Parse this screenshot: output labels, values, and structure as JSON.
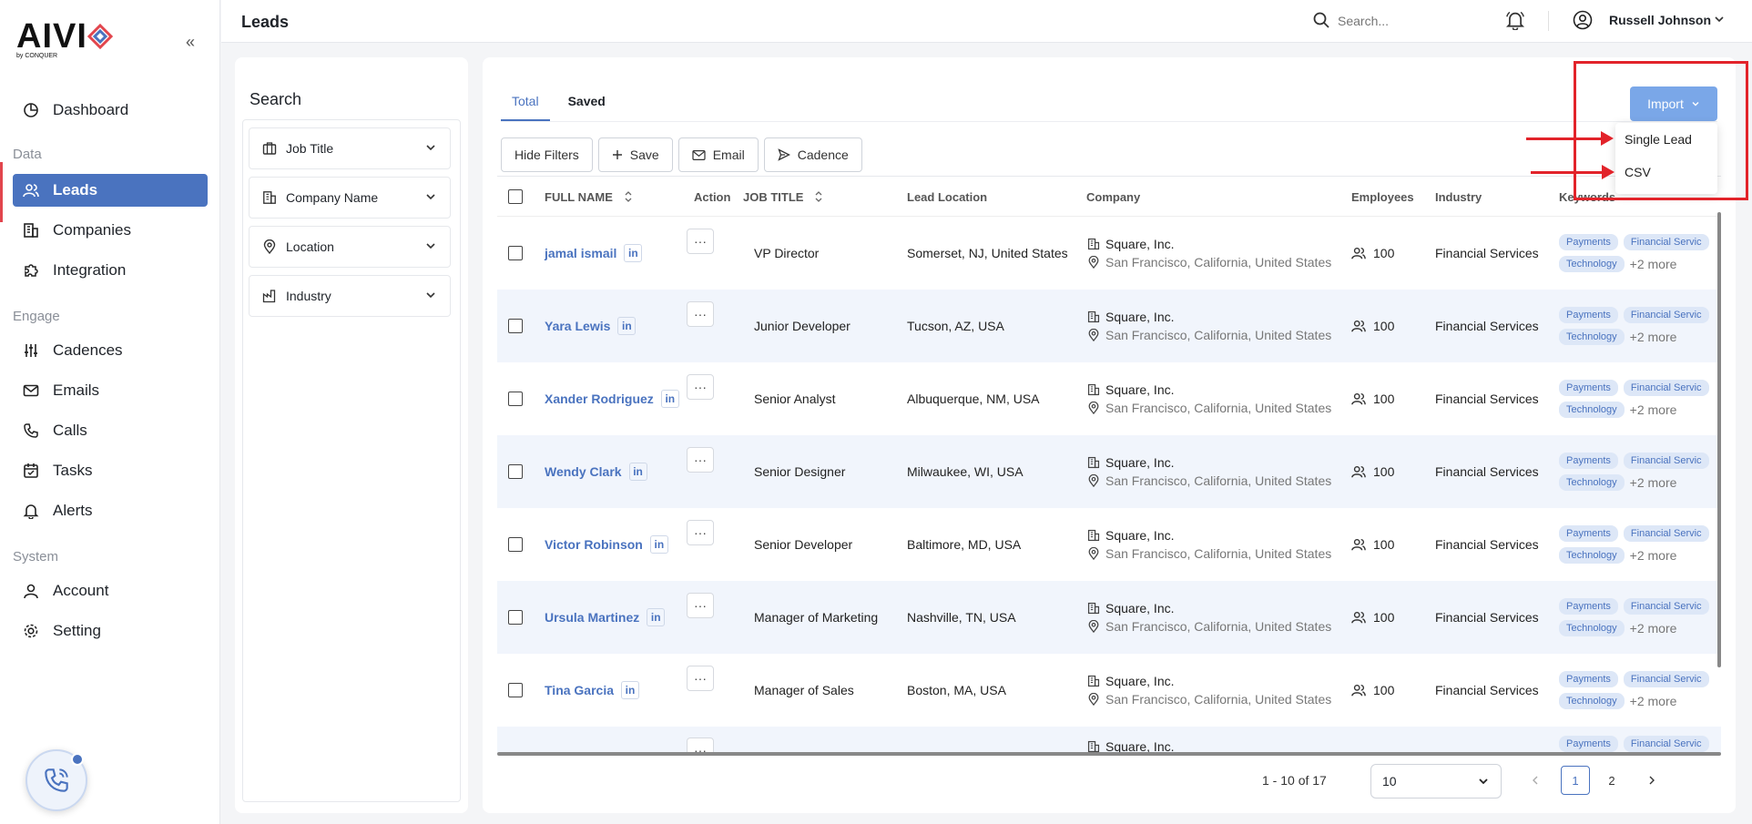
{
  "app": {
    "logo_text": "AIVI",
    "logo_sub": "by CONQUER"
  },
  "sidebar": {
    "items": [
      {
        "label": "Dashboard",
        "icon": "dashboard-icon"
      },
      {
        "label": "Leads",
        "icon": "users-icon",
        "active": true
      },
      {
        "label": "Companies",
        "icon": "building-icon"
      },
      {
        "label": "Integration",
        "icon": "puzzle-icon"
      },
      {
        "label": "Cadences",
        "icon": "sliders-icon"
      },
      {
        "label": "Emails",
        "icon": "mail-icon"
      },
      {
        "label": "Calls",
        "icon": "phone-icon"
      },
      {
        "label": "Tasks",
        "icon": "calendar-icon"
      },
      {
        "label": "Alerts",
        "icon": "bell-icon"
      },
      {
        "label": "Account",
        "icon": "user-icon"
      },
      {
        "label": "Setting",
        "icon": "gear-icon"
      }
    ],
    "sections": [
      "Data",
      "Engage",
      "System"
    ]
  },
  "header": {
    "title": "Leads",
    "search_placeholder": "Search...",
    "user_name": "Russell Johnson"
  },
  "filters": {
    "title": "Search",
    "items": [
      {
        "label": "Job Title"
      },
      {
        "label": "Company Name"
      },
      {
        "label": "Location"
      },
      {
        "label": "Industry"
      }
    ]
  },
  "main": {
    "tabs": [
      {
        "label": "Total",
        "active": true
      },
      {
        "label": "Saved"
      }
    ],
    "toolbar": {
      "hide_filters": "Hide Filters",
      "save": "Save",
      "email": "Email",
      "cadence": "Cadence"
    },
    "import": {
      "label": "Import",
      "menu": [
        "Single Lead",
        "CSV"
      ]
    },
    "table": {
      "columns": [
        "FULL NAME",
        "Action",
        "JOB TITLE",
        "Lead Location",
        "Company",
        "Employees",
        "Industry",
        "Keywords"
      ],
      "rows": [
        {
          "name": "jamal ismail",
          "title": "VP Director",
          "location": "Somerset, NJ, United States",
          "company": "Square, Inc.",
          "company_loc": "San Francisco, California, United States",
          "employees": "100",
          "industry": "Financial Services",
          "kw1": "Payments",
          "kw2": "Financial Servic",
          "kw3": "Technology",
          "more": "+2 more"
        },
        {
          "name": "Yara Lewis",
          "title": "Junior Developer",
          "location": "Tucson, AZ, USA",
          "company": "Square, Inc.",
          "company_loc": "San Francisco, California, United States",
          "employees": "100",
          "industry": "Financial Services",
          "kw1": "Payments",
          "kw2": "Financial Servic",
          "kw3": "Technology",
          "more": "+2 more"
        },
        {
          "name": "Xander Rodriguez",
          "title": "Senior Analyst",
          "location": "Albuquerque, NM, USA",
          "company": "Square, Inc.",
          "company_loc": "San Francisco, California, United States",
          "employees": "100",
          "industry": "Financial Services",
          "kw1": "Payments",
          "kw2": "Financial Servic",
          "kw3": "Technology",
          "more": "+2 more"
        },
        {
          "name": "Wendy Clark",
          "title": "Senior Designer",
          "location": "Milwaukee, WI, USA",
          "company": "Square, Inc.",
          "company_loc": "San Francisco, California, United States",
          "employees": "100",
          "industry": "Financial Services",
          "kw1": "Payments",
          "kw2": "Financial Servic",
          "kw3": "Technology",
          "more": "+2 more"
        },
        {
          "name": "Victor Robinson",
          "title": "Senior Developer",
          "location": "Baltimore, MD, USA",
          "company": "Square, Inc.",
          "company_loc": "San Francisco, California, United States",
          "employees": "100",
          "industry": "Financial Services",
          "kw1": "Payments",
          "kw2": "Financial Servic",
          "kw3": "Technology",
          "more": "+2 more"
        },
        {
          "name": "Ursula Martinez",
          "title": "Manager of Marketing",
          "location": "Nashville, TN, USA",
          "company": "Square, Inc.",
          "company_loc": "San Francisco, California, United States",
          "employees": "100",
          "industry": "Financial Services",
          "kw1": "Payments",
          "kw2": "Financial Servic",
          "kw3": "Technology",
          "more": "+2 more"
        },
        {
          "name": "Tina Garcia",
          "title": "Manager of Sales",
          "location": "Boston, MA, USA",
          "company": "Square, Inc.",
          "company_loc": "San Francisco, California, United States",
          "employees": "100",
          "industry": "Financial Services",
          "kw1": "Payments",
          "kw2": "Financial Servic",
          "kw3": "Technology",
          "more": "+2 more"
        },
        {
          "name": "",
          "title": "",
          "location": "",
          "company": "Square, Inc.",
          "company_loc": "",
          "employees": "",
          "industry": "",
          "kw1": "Payments",
          "kw2": "Financial Servic",
          "kw3": "",
          "more": ""
        }
      ]
    },
    "pagination": {
      "range": "1 - 10 of 17",
      "page_size": "10",
      "pages": [
        "1",
        "2"
      ],
      "current": "1"
    }
  },
  "colors": {
    "accent": "#4a73bf",
    "import_button": "#7aa7e8",
    "annotation": "#e2232a"
  }
}
